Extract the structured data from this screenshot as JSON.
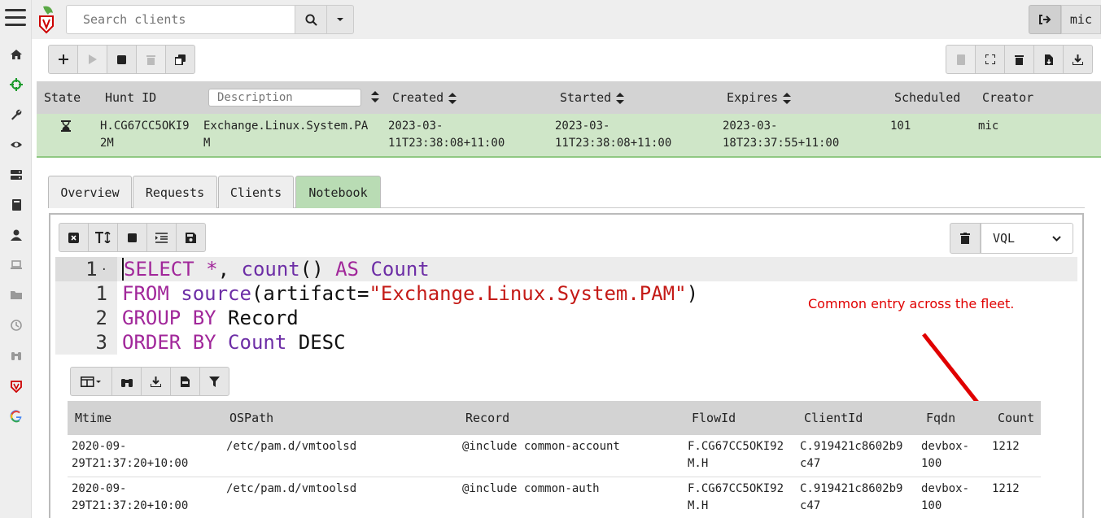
{
  "header": {
    "search_placeholder": "Search clients",
    "username": "mic"
  },
  "sidebar": {
    "items": [
      "home-icon",
      "crosshairs-icon",
      "wrench-icon",
      "eye-icon",
      "server-icon",
      "book-icon",
      "user-icon",
      "laptop-icon",
      "folder-icon",
      "history-icon",
      "binoculars-icon",
      "velociraptor-icon",
      "google-icon"
    ]
  },
  "hunts": {
    "columns": {
      "state": "State",
      "hunt_id": "Hunt ID",
      "description_placeholder": "Description",
      "created": "Created",
      "started": "Started",
      "expires": "Expires",
      "scheduled": "Scheduled",
      "creator": "Creator"
    },
    "row": {
      "state_icon": "hourglass-icon",
      "hunt_id_1": "H.CG67CC5OKI9",
      "hunt_id_2": "2M",
      "description_1": "Exchange.Linux.System.PA",
      "description_2": "M",
      "created_1": "2023-03-",
      "created_2": "11T23:38:08+11:00",
      "started_1": "2023-03-",
      "started_2": "11T23:38:08+11:00",
      "expires_1": "2023-03-",
      "expires_2": "18T23:37:55+11:00",
      "scheduled": "101",
      "creator": "mic"
    }
  },
  "tabs": [
    "Overview",
    "Requests",
    "Clients",
    "Notebook"
  ],
  "active_tab": "Notebook",
  "notebook": {
    "language": "VQL",
    "line_numbers": [
      "1",
      "1",
      "2",
      "3"
    ],
    "code": {
      "l1_kw1": "SELECT *",
      "l1_a": ", ",
      "l1_fn": "count",
      "l1_b": "() ",
      "l1_kw2": "AS",
      "l1_c": " ",
      "l1_fn2": "Count",
      "l2_kw": "FROM",
      "l2_a": " ",
      "l2_fn": "source",
      "l2_b": "(artifact=",
      "l2_str": "\"Exchange.Linux.System.PAM\"",
      "l2_c": ")",
      "l3_kw": "GROUP BY",
      "l3_a": " Record",
      "l4_kw": "ORDER BY",
      "l4_a": " ",
      "l4_fn": "Count",
      "l4_b": " DESC"
    },
    "annotation": "Common entry across the fleet.",
    "annotation_color": "#e00000"
  },
  "results": {
    "columns": [
      "Mtime",
      "OSPath",
      "Record",
      "FlowId",
      "ClientId",
      "Fqdn",
      "Count"
    ],
    "rows": [
      {
        "mtime_1": "2020-09-",
        "mtime_2": "29T21:37:20+10:00",
        "ospath": "/etc/pam.d/vmtoolsd",
        "record": "@include common-account",
        "flowid_1": "F.CG67CC5OKI92",
        "flowid_2": "M.H",
        "clientid_1": "C.919421c8602b9",
        "clientid_2": "c47",
        "fqdn_1": "devbox-",
        "fqdn_2": "100",
        "count": "1212"
      },
      {
        "mtime_1": "2020-09-",
        "mtime_2": "29T21:37:20+10:00",
        "ospath": "/etc/pam.d/vmtoolsd",
        "record": "@include common-auth",
        "flowid_1": "F.CG67CC5OKI92",
        "flowid_2": "M.H",
        "clientid_1": "C.919421c8602b9",
        "clientid_2": "c47",
        "fqdn_1": "devbox-",
        "fqdn_2": "100",
        "count": "1212"
      }
    ]
  },
  "colors": {
    "active_green": "#b9dcb4",
    "selected_row": "#cfe6c8",
    "keyword": "#a1279a",
    "string": "#c41a16"
  }
}
